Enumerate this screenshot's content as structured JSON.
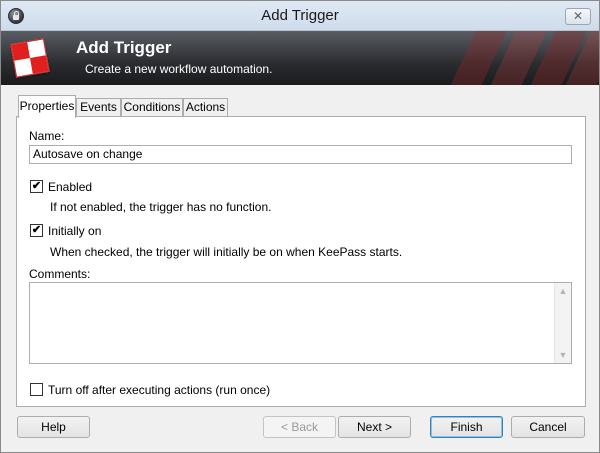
{
  "window": {
    "title": "Add Trigger",
    "close_glyph": "✕"
  },
  "banner": {
    "title": "Add Trigger",
    "subtitle": "Create a new workflow automation."
  },
  "tabs": [
    {
      "label": "Properties",
      "active": true
    },
    {
      "label": "Events",
      "active": false
    },
    {
      "label": "Conditions",
      "active": false
    },
    {
      "label": "Actions",
      "active": false
    }
  ],
  "properties": {
    "name_label": "Name:",
    "name_value": "Autosave on change",
    "enabled": {
      "label": "Enabled",
      "checked": true,
      "description": "If not enabled, the trigger has no function."
    },
    "initially_on": {
      "label": "Initially on",
      "checked": true,
      "description": "When checked, the trigger will initially be on when KeePass starts."
    },
    "comments_label": "Comments:",
    "comments_value": "",
    "run_once": {
      "label": "Turn off after executing actions (run once)",
      "checked": false
    }
  },
  "buttons": {
    "help": "Help",
    "back": "< Back",
    "next": "Next >",
    "finish": "Finish",
    "cancel": "Cancel"
  },
  "icons": {
    "app": "keepass-lock-icon",
    "banner": "trigger-logo-icon",
    "check_glyph": "✔"
  }
}
